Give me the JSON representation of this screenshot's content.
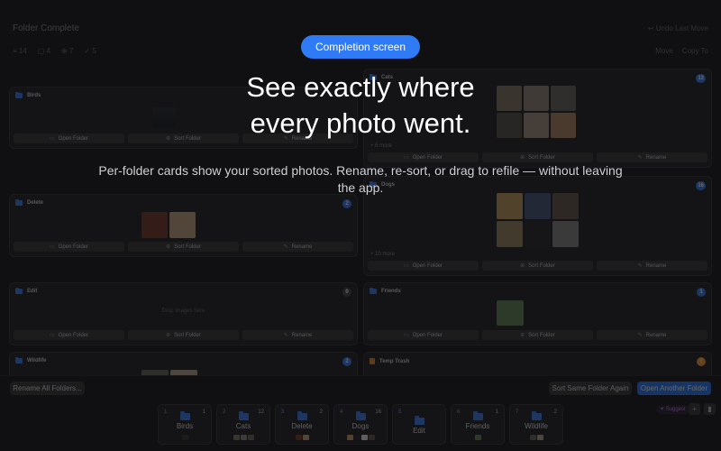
{
  "overlay": {
    "badge": "Completion screen",
    "headline_line1": "See exactly where",
    "headline_line2": "every photo went.",
    "sub_line1": "Per-folder cards show your sorted photos. Rename, re-sort, or drag to refile — without leaving",
    "sub_line2": "the app."
  },
  "header": {
    "title": "Folder Complete",
    "right_text": "↩ Undo Last Move",
    "stats": [
      "≡ 14",
      "▢ 4",
      "⊕ 7",
      "✓ 5"
    ],
    "stats_right": [
      "Move",
      "Copy To"
    ]
  },
  "actions": {
    "open": "Open Folder",
    "sort": "Sort Folder",
    "rename": "Rename"
  },
  "cards": [
    {
      "id": "birds",
      "name": "Birds",
      "count": "",
      "more": ""
    },
    {
      "id": "cats",
      "name": "Cats",
      "count": "12",
      "more": "+ 6 more"
    },
    {
      "id": "delete",
      "name": "Delete",
      "count": "2",
      "more": ""
    },
    {
      "id": "dogs",
      "name": "Dogs",
      "count": "16",
      "more": "+ 10 more"
    },
    {
      "id": "edit",
      "name": "Edit",
      "count": "0",
      "more": "",
      "drop": "Drop images here"
    },
    {
      "id": "friends",
      "name": "Friends",
      "count": "1",
      "more": ""
    },
    {
      "id": "wildlife",
      "name": "Wildlife",
      "count": "2",
      "more": ""
    },
    {
      "id": "trash",
      "name": "Temp Trash",
      "count": "!",
      "more": ""
    }
  ],
  "footer": {
    "rename_all": "Rename All Folders...",
    "sort_again": "Sort Same Folder Again",
    "open_another": "Open Another Folder",
    "suggest": "✦ Suggest",
    "plus": "+",
    "bookmark": "▮"
  },
  "tiles": [
    {
      "num": "1",
      "name": "Birds",
      "count": "1"
    },
    {
      "num": "2",
      "name": "Cats",
      "count": "12"
    },
    {
      "num": "3",
      "name": "Delete",
      "count": "2"
    },
    {
      "num": "4",
      "name": "Dogs",
      "count": "16"
    },
    {
      "num": "5",
      "name": "Edit",
      "count": ""
    },
    {
      "num": "6",
      "name": "Friends",
      "count": "1"
    },
    {
      "num": "7",
      "name": "Wildlife",
      "count": "2"
    }
  ]
}
